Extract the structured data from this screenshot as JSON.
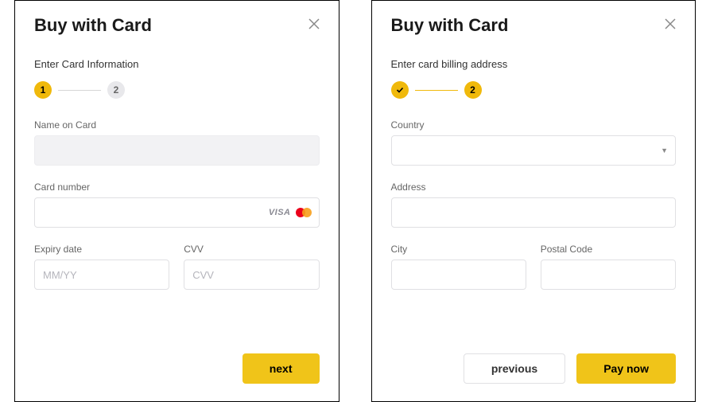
{
  "panel1": {
    "title": "Buy with Card",
    "subtitle": "Enter Card Information",
    "steps": [
      "1",
      "2"
    ],
    "name_label": "Name on Card",
    "cardnum_label": "Card number",
    "expiry_label": "Expiry date",
    "expiry_placeholder": "MM/YY",
    "cvv_label": "CVV",
    "cvv_placeholder": "CVV",
    "visa_brand": "VISA",
    "next_label": "next"
  },
  "panel2": {
    "title": "Buy with Card",
    "subtitle": "Enter card billing address",
    "step2": "2",
    "country_label": "Country",
    "address_label": "Address",
    "city_label": "City",
    "postal_label": "Postal Code",
    "previous_label": "previous",
    "paynow_label": "Pay now"
  }
}
